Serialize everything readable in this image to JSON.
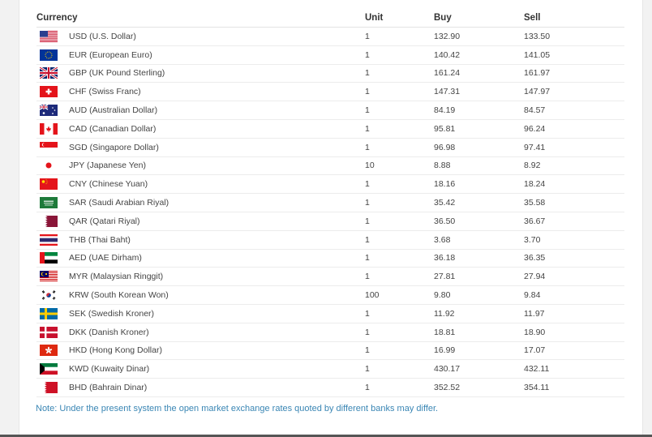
{
  "table": {
    "headers": {
      "currency": "Currency",
      "unit": "Unit",
      "buy": "Buy",
      "sell": "Sell"
    },
    "rows": [
      {
        "flag": "us-flag-icon",
        "currency": "USD (U.S. Dollar)",
        "unit": "1",
        "buy": "132.90",
        "sell": "133.50"
      },
      {
        "flag": "eu-flag-icon",
        "currency": "EUR (European Euro)",
        "unit": "1",
        "buy": "140.42",
        "sell": "141.05"
      },
      {
        "flag": "uk-flag-icon",
        "currency": "GBP (UK Pound Sterling)",
        "unit": "1",
        "buy": "161.24",
        "sell": "161.97"
      },
      {
        "flag": "ch-flag-icon",
        "currency": "CHF (Swiss Franc)",
        "unit": "1",
        "buy": "147.31",
        "sell": "147.97"
      },
      {
        "flag": "au-flag-icon",
        "currency": "AUD (Australian Dollar)",
        "unit": "1",
        "buy": "84.19",
        "sell": "84.57"
      },
      {
        "flag": "ca-flag-icon",
        "currency": "CAD (Canadian Dollar)",
        "unit": "1",
        "buy": "95.81",
        "sell": "96.24"
      },
      {
        "flag": "sg-flag-icon",
        "currency": "SGD (Singapore Dollar)",
        "unit": "1",
        "buy": "96.98",
        "sell": "97.41"
      },
      {
        "flag": "jp-flag-icon",
        "currency": "JPY (Japanese Yen)",
        "unit": "10",
        "buy": "8.88",
        "sell": "8.92"
      },
      {
        "flag": "cn-flag-icon",
        "currency": "CNY (Chinese Yuan)",
        "unit": "1",
        "buy": "18.16",
        "sell": "18.24"
      },
      {
        "flag": "sa-flag-icon",
        "currency": "SAR (Saudi Arabian Riyal)",
        "unit": "1",
        "buy": "35.42",
        "sell": "35.58"
      },
      {
        "flag": "qa-flag-icon",
        "currency": "QAR (Qatari Riyal)",
        "unit": "1",
        "buy": "36.50",
        "sell": "36.67"
      },
      {
        "flag": "th-flag-icon",
        "currency": "THB (Thai Baht)",
        "unit": "1",
        "buy": "3.68",
        "sell": "3.70"
      },
      {
        "flag": "ae-flag-icon",
        "currency": "AED (UAE Dirham)",
        "unit": "1",
        "buy": "36.18",
        "sell": "36.35"
      },
      {
        "flag": "my-flag-icon",
        "currency": "MYR (Malaysian Ringgit)",
        "unit": "1",
        "buy": "27.81",
        "sell": "27.94"
      },
      {
        "flag": "kr-flag-icon",
        "currency": "KRW (South Korean Won)",
        "unit": "100",
        "buy": "9.80",
        "sell": "9.84"
      },
      {
        "flag": "se-flag-icon",
        "currency": "SEK (Swedish Kroner)",
        "unit": "1",
        "buy": "11.92",
        "sell": "11.97"
      },
      {
        "flag": "dk-flag-icon",
        "currency": "DKK (Danish Kroner)",
        "unit": "1",
        "buy": "18.81",
        "sell": "18.90"
      },
      {
        "flag": "hk-flag-icon",
        "currency": "HKD (Hong Kong Dollar)",
        "unit": "1",
        "buy": "16.99",
        "sell": "17.07"
      },
      {
        "flag": "kw-flag-icon",
        "currency": "KWD (Kuwaity Dinar)",
        "unit": "1",
        "buy": "430.17",
        "sell": "432.11"
      },
      {
        "flag": "bh-flag-icon",
        "currency": "BHD (Bahrain Dinar)",
        "unit": "1",
        "buy": "352.52",
        "sell": "354.11"
      }
    ]
  },
  "note": "Note: Under the present system the open market exchange rates quoted by different banks may differ."
}
